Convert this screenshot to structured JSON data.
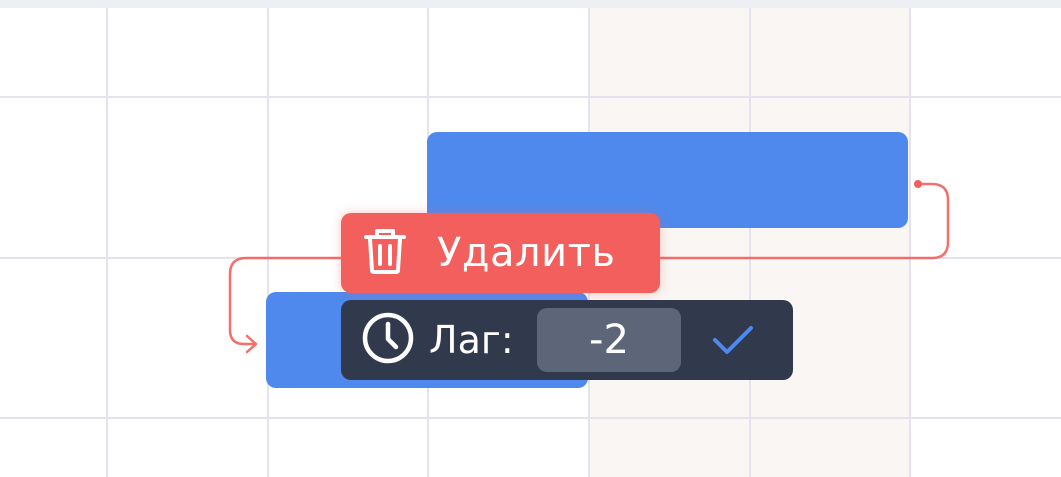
{
  "toolbar": {
    "delete_label": "Удалить"
  },
  "lag_editor": {
    "label": "Лаг:",
    "value": "-2"
  },
  "icons": {
    "delete": "trash-icon",
    "lag": "clock-icon",
    "confirm": "check-icon"
  },
  "colors": {
    "task_bar": "#4f89ee",
    "delete_button": "#f25f5c",
    "dependency_line": "#f2605d",
    "lag_panel": "#313a4c",
    "lag_input": "#5c6678",
    "confirm_check": "#4f89ee",
    "weekend_column": "#f9f6f4",
    "grid_line": "#e4e2ee"
  }
}
